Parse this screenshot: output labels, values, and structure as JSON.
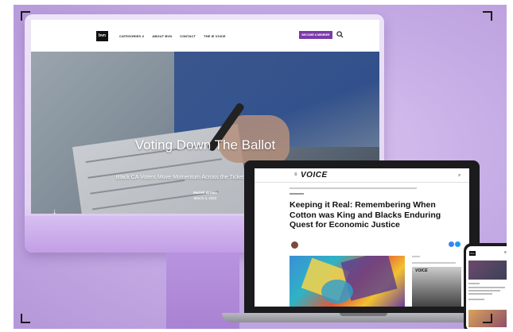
{
  "desktop_site": {
    "logo_text": "bvn",
    "nav": [
      "CATEGORIES ∨",
      "ABOUT BVN",
      "CONTACT",
      "THE IE VOICE"
    ],
    "cta_label": "BECOME A MEMBER",
    "hero": {
      "title": "Voting Down The Ballot",
      "subtitle": "Black CA Voters Move Momentum Across the Ticket For Lasting Change",
      "author": "Marleh Brown",
      "date": "March 3, 2022",
      "scroll_arrow": "↓"
    }
  },
  "laptop_site": {
    "menu_icon": "≡",
    "logo_text": "VOICE",
    "search_icon": "⌕",
    "article_title": "Keeping it Real: Remembering When Cotton was King and Blacks Enduring Quest for Economic Justice",
    "sidebar_image_label": "VOICE"
  },
  "phone_site": {
    "logo_text": "bvn",
    "menu_icon": "≡"
  },
  "colors": {
    "accent_purple": "#7a3aa8",
    "backdrop_lavender": "#c7aee6"
  }
}
